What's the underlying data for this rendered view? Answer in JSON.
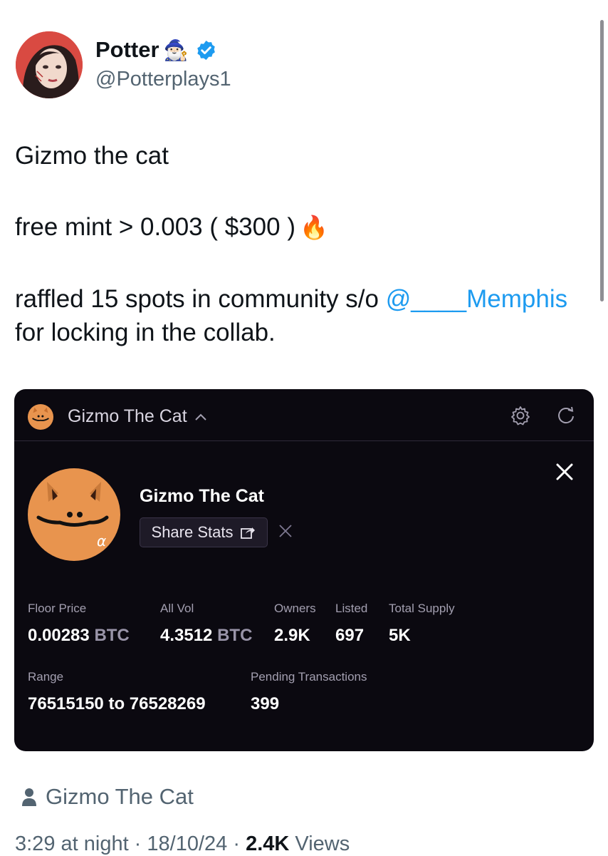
{
  "author": {
    "name": "Potter",
    "handle": "@Potterplays1",
    "name_emoji": "🧙🏻‍♂️"
  },
  "tweet": {
    "line1": "Gizmo the cat",
    "line2": "free mint > 0.003 ( $300 )",
    "line2_emoji": "🔥",
    "line3_prefix": "raffled 15 spots in community s/o ",
    "mention": "@____Memphis",
    "line4": "for locking in the collab."
  },
  "card": {
    "header_title": "Gizmo The Cat",
    "collection_name": "Gizmo The Cat",
    "share_label": "Share Stats",
    "stats": {
      "floor_price_label": "Floor Price",
      "floor_price_value": "0.00283",
      "floor_price_unit": "BTC",
      "all_vol_label": "All Vol",
      "all_vol_value": "4.3512",
      "all_vol_unit": "BTC",
      "owners_label": "Owners",
      "owners_value": "2.9K",
      "listed_label": "Listed",
      "listed_value": "697",
      "total_supply_label": "Total Supply",
      "total_supply_value": "5K",
      "range_label": "Range",
      "range_value": "76515150 to 76528269",
      "pending_label": "Pending Transactions",
      "pending_value": "399"
    }
  },
  "footer": {
    "attribution": "Gizmo The Cat",
    "time": "3:29 at night · 18/10/24 · ",
    "views_count": "2.4K",
    "views_label": " Views"
  },
  "colors": {
    "link": "#1d9bf0",
    "secondary_text": "#536471",
    "card_bg": "#0b0910",
    "verified": "#1d9bf0",
    "gizmo_orange": "#e8944e"
  }
}
